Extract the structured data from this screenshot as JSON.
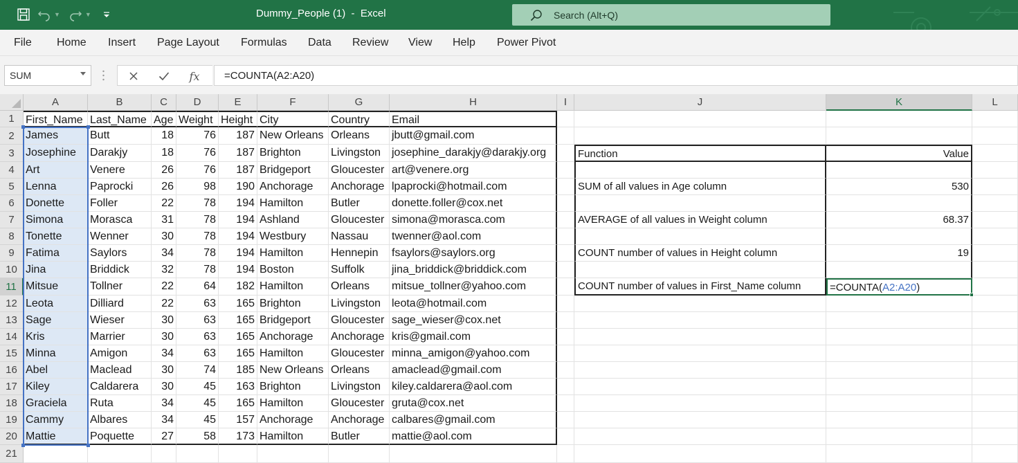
{
  "window": {
    "title": "Dummy_People (1)  -  Excel",
    "search_placeholder": "Search (Alt+Q)"
  },
  "ribbon_tabs": [
    "File",
    "Home",
    "Insert",
    "Page Layout",
    "Formulas",
    "Data",
    "Review",
    "View",
    "Help",
    "Power Pivot"
  ],
  "formula_bar": {
    "name_box": "SUM",
    "formula": "=COUNTA(A2:A20)",
    "fx_label": "fx"
  },
  "columns": [
    "A",
    "B",
    "C",
    "D",
    "E",
    "F",
    "G",
    "H",
    "I",
    "J",
    "K",
    "L"
  ],
  "rows": [
    "1",
    "2",
    "3",
    "4",
    "5",
    "6",
    "7",
    "8",
    "9",
    "10",
    "11",
    "12",
    "13",
    "14",
    "15",
    "16",
    "17",
    "18",
    "19",
    "20",
    "21"
  ],
  "table": {
    "headers": [
      "First_Name",
      "Last_Name",
      "Age",
      "Weight",
      "Height",
      "City",
      "Country",
      "Email"
    ],
    "rows": [
      [
        "James",
        "Butt",
        "18",
        "76",
        "187",
        "New Orleans",
        "Orleans",
        "jbutt@gmail.com"
      ],
      [
        "Josephine",
        "Darakjy",
        "18",
        "76",
        "187",
        "Brighton",
        "Livingston",
        "josephine_darakjy@darakjy.org"
      ],
      [
        "Art",
        "Venere",
        "26",
        "76",
        "187",
        "Bridgeport",
        "Gloucester",
        "art@venere.org"
      ],
      [
        "Lenna",
        "Paprocki",
        "26",
        "98",
        "190",
        "Anchorage",
        "Anchorage",
        "lpaprocki@hotmail.com"
      ],
      [
        "Donette",
        "Foller",
        "22",
        "78",
        "194",
        "Hamilton",
        "Butler",
        "donette.foller@cox.net"
      ],
      [
        "Simona",
        "Morasca",
        "31",
        "78",
        "194",
        "Ashland",
        "Gloucester",
        "simona@morasca.com"
      ],
      [
        "Tonette",
        "Wenner",
        "30",
        "78",
        "194",
        "Westbury",
        "Nassau",
        "twenner@aol.com"
      ],
      [
        "Fatima",
        "Saylors",
        "34",
        "78",
        "194",
        "Hamilton",
        "Hennepin",
        "fsaylors@saylors.org"
      ],
      [
        "Jina",
        "Briddick",
        "32",
        "78",
        "194",
        "Boston",
        "Suffolk",
        "jina_briddick@briddick.com"
      ],
      [
        "Mitsue",
        "Tollner",
        "22",
        "64",
        "182",
        "Hamilton",
        "Orleans",
        "mitsue_tollner@yahoo.com"
      ],
      [
        "Leota",
        "Dilliard",
        "22",
        "63",
        "165",
        "Brighton",
        "Livingston",
        "leota@hotmail.com"
      ],
      [
        "Sage",
        "Wieser",
        "30",
        "63",
        "165",
        "Bridgeport",
        "Gloucester",
        "sage_wieser@cox.net"
      ],
      [
        "Kris",
        "Marrier",
        "30",
        "63",
        "165",
        "Anchorage",
        "Anchorage",
        "kris@gmail.com"
      ],
      [
        "Minna",
        "Amigon",
        "34",
        "63",
        "165",
        "Hamilton",
        "Gloucester",
        "minna_amigon@yahoo.com"
      ],
      [
        "Abel",
        "Maclead",
        "30",
        "74",
        "185",
        "New Orleans",
        "Orleans",
        "amaclead@gmail.com"
      ],
      [
        "Kiley",
        "Caldarera",
        "30",
        "45",
        "163",
        "Brighton",
        "Livingston",
        "kiley.caldarera@aol.com"
      ],
      [
        "Graciela",
        "Ruta",
        "34",
        "45",
        "165",
        "Hamilton",
        "Gloucester",
        "gruta@cox.net"
      ],
      [
        "Cammy",
        "Albares",
        "34",
        "45",
        "157",
        "Anchorage",
        "Anchorage",
        "calbares@gmail.com"
      ],
      [
        "Mattie",
        "Poquette",
        "27",
        "58",
        "173",
        "Hamilton",
        "Butler",
        "mattie@aol.com"
      ]
    ]
  },
  "summary": {
    "header_function": "Function",
    "header_value": "Value",
    "rows": [
      {
        "function": "SUM of all values in Age column",
        "value": "530"
      },
      {
        "function": "AVERAGE of all values in Weight column",
        "value": "68.37"
      },
      {
        "function": "COUNT number of values in Height column",
        "value": "19"
      },
      {
        "function": "COUNT number of values in First_Name column",
        "value_prefix": "=COUNTA(",
        "value_ref": "A2:A20",
        "value_suffix": ")"
      }
    ]
  },
  "colors": {
    "accent": "#217346",
    "range_ref": "#4472c4",
    "selection": "#dde8f5"
  }
}
